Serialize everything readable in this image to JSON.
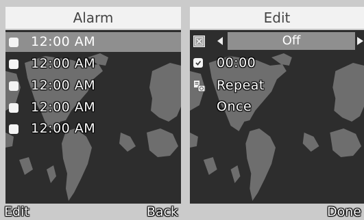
{
  "alarm_screen": {
    "title": "Alarm",
    "alarms": [
      {
        "time": "12:00 AM",
        "enabled": false
      },
      {
        "time": "12:00 AM",
        "enabled": false
      },
      {
        "time": "12:00 AM",
        "enabled": false
      },
      {
        "time": "12:00 AM",
        "enabled": false
      },
      {
        "time": "12:00 AM",
        "enabled": false
      }
    ],
    "softkeys": {
      "left": "Edit",
      "right": "Back"
    }
  },
  "edit_screen": {
    "title": "Edit",
    "state_value": "Off",
    "time_value": "00:00",
    "repeat_label": "Repeat",
    "repeat_value": "Once",
    "softkeys": {
      "left": "",
      "right": "Done"
    }
  },
  "colors": {
    "background": "#cbcbcb",
    "title_bar": "#f2f2f2",
    "content_bg": "#2d2d2d",
    "map_land": "#6e6e6e",
    "highlight": "#8f8f8f"
  },
  "icons": [
    "world-map",
    "checkbox-icon",
    "close-box-icon",
    "arrow-left-icon",
    "arrow-right-icon",
    "clock-icon",
    "repeat-icon"
  ]
}
